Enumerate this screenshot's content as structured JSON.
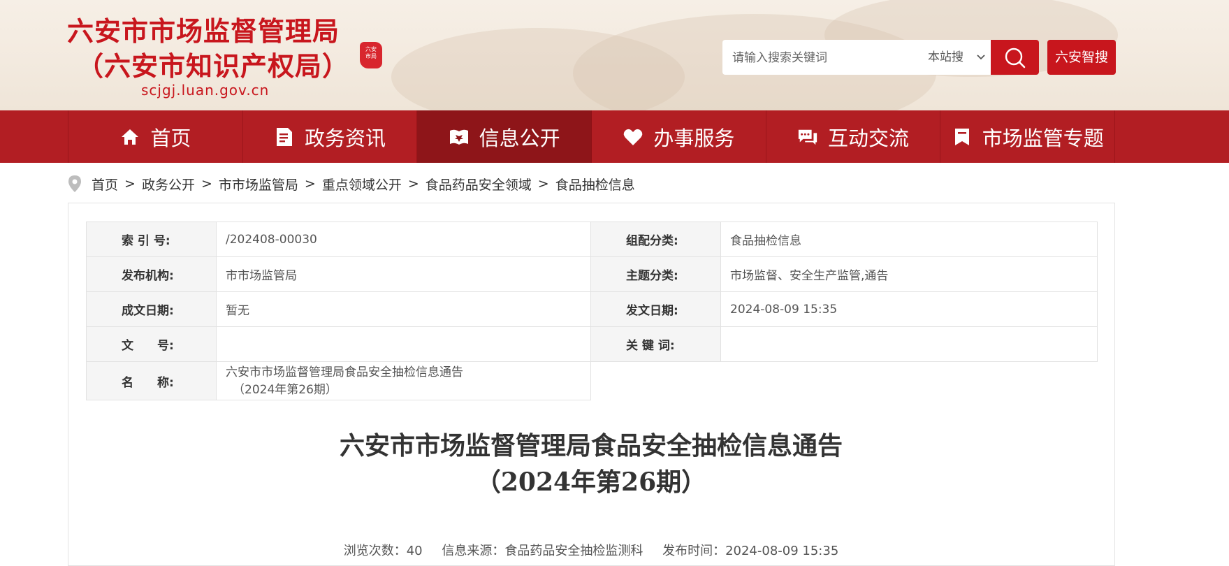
{
  "header": {
    "logo_line1": "六安市市场监督管理局",
    "logo_line2": "（六安市知识产权局）",
    "domain": "scjgj.luan.gov.cn",
    "search_placeholder": "请输入搜索关键词",
    "search_scope": "本站搜",
    "smart_search_label": "六安智搜",
    "brand_color": "#c8161d"
  },
  "nav": {
    "items": [
      {
        "label": "首页",
        "icon": "home-icon"
      },
      {
        "label": "政务资讯",
        "icon": "document-icon"
      },
      {
        "label": "信息公开",
        "icon": "open-book-icon"
      },
      {
        "label": "办事服务",
        "icon": "heart-hand-icon"
      },
      {
        "label": "互动交流",
        "icon": "chat-icon"
      },
      {
        "label": "市场监管专题",
        "icon": "bookmark-icon"
      }
    ],
    "active_index": 2
  },
  "breadcrumb": {
    "items": [
      "首页",
      "政务公开",
      "市市场监管局",
      "重点领域公开",
      "食品药品安全领域",
      "食品抽检信息"
    ],
    "separator": ">"
  },
  "meta": {
    "index_label": "索 引 号:",
    "index_value": "/202408-00030",
    "category_label": "组配分类:",
    "category_value": "食品抽检信息",
    "publisher_label": "发布机构:",
    "publisher_value": "市市场监管局",
    "topic_label": "主题分类:",
    "topic_value": "市场监督、安全生产监管,通告",
    "created_label": "成文日期:",
    "created_value": "暂无",
    "issued_label": "发文日期:",
    "issued_value": "2024-08-09 15:35",
    "docno_label": "文　　号:",
    "docno_value": "",
    "keywords_label": "关 键 词:",
    "keywords_value": "",
    "name_label": "名　　称:",
    "name_value_line1": "六安市市场监督管理局食品安全抽检信息通告",
    "name_value_line2": "（2024年第26期）"
  },
  "article": {
    "title_line1": "六安市市场监督管理局食品安全抽检信息通告",
    "title_line2": "（2024年第26期）",
    "views": "浏览次数：40",
    "source": "信息来源：食品药品安全抽检监测科",
    "published": "发布时间：2024-08-09 15:35"
  }
}
